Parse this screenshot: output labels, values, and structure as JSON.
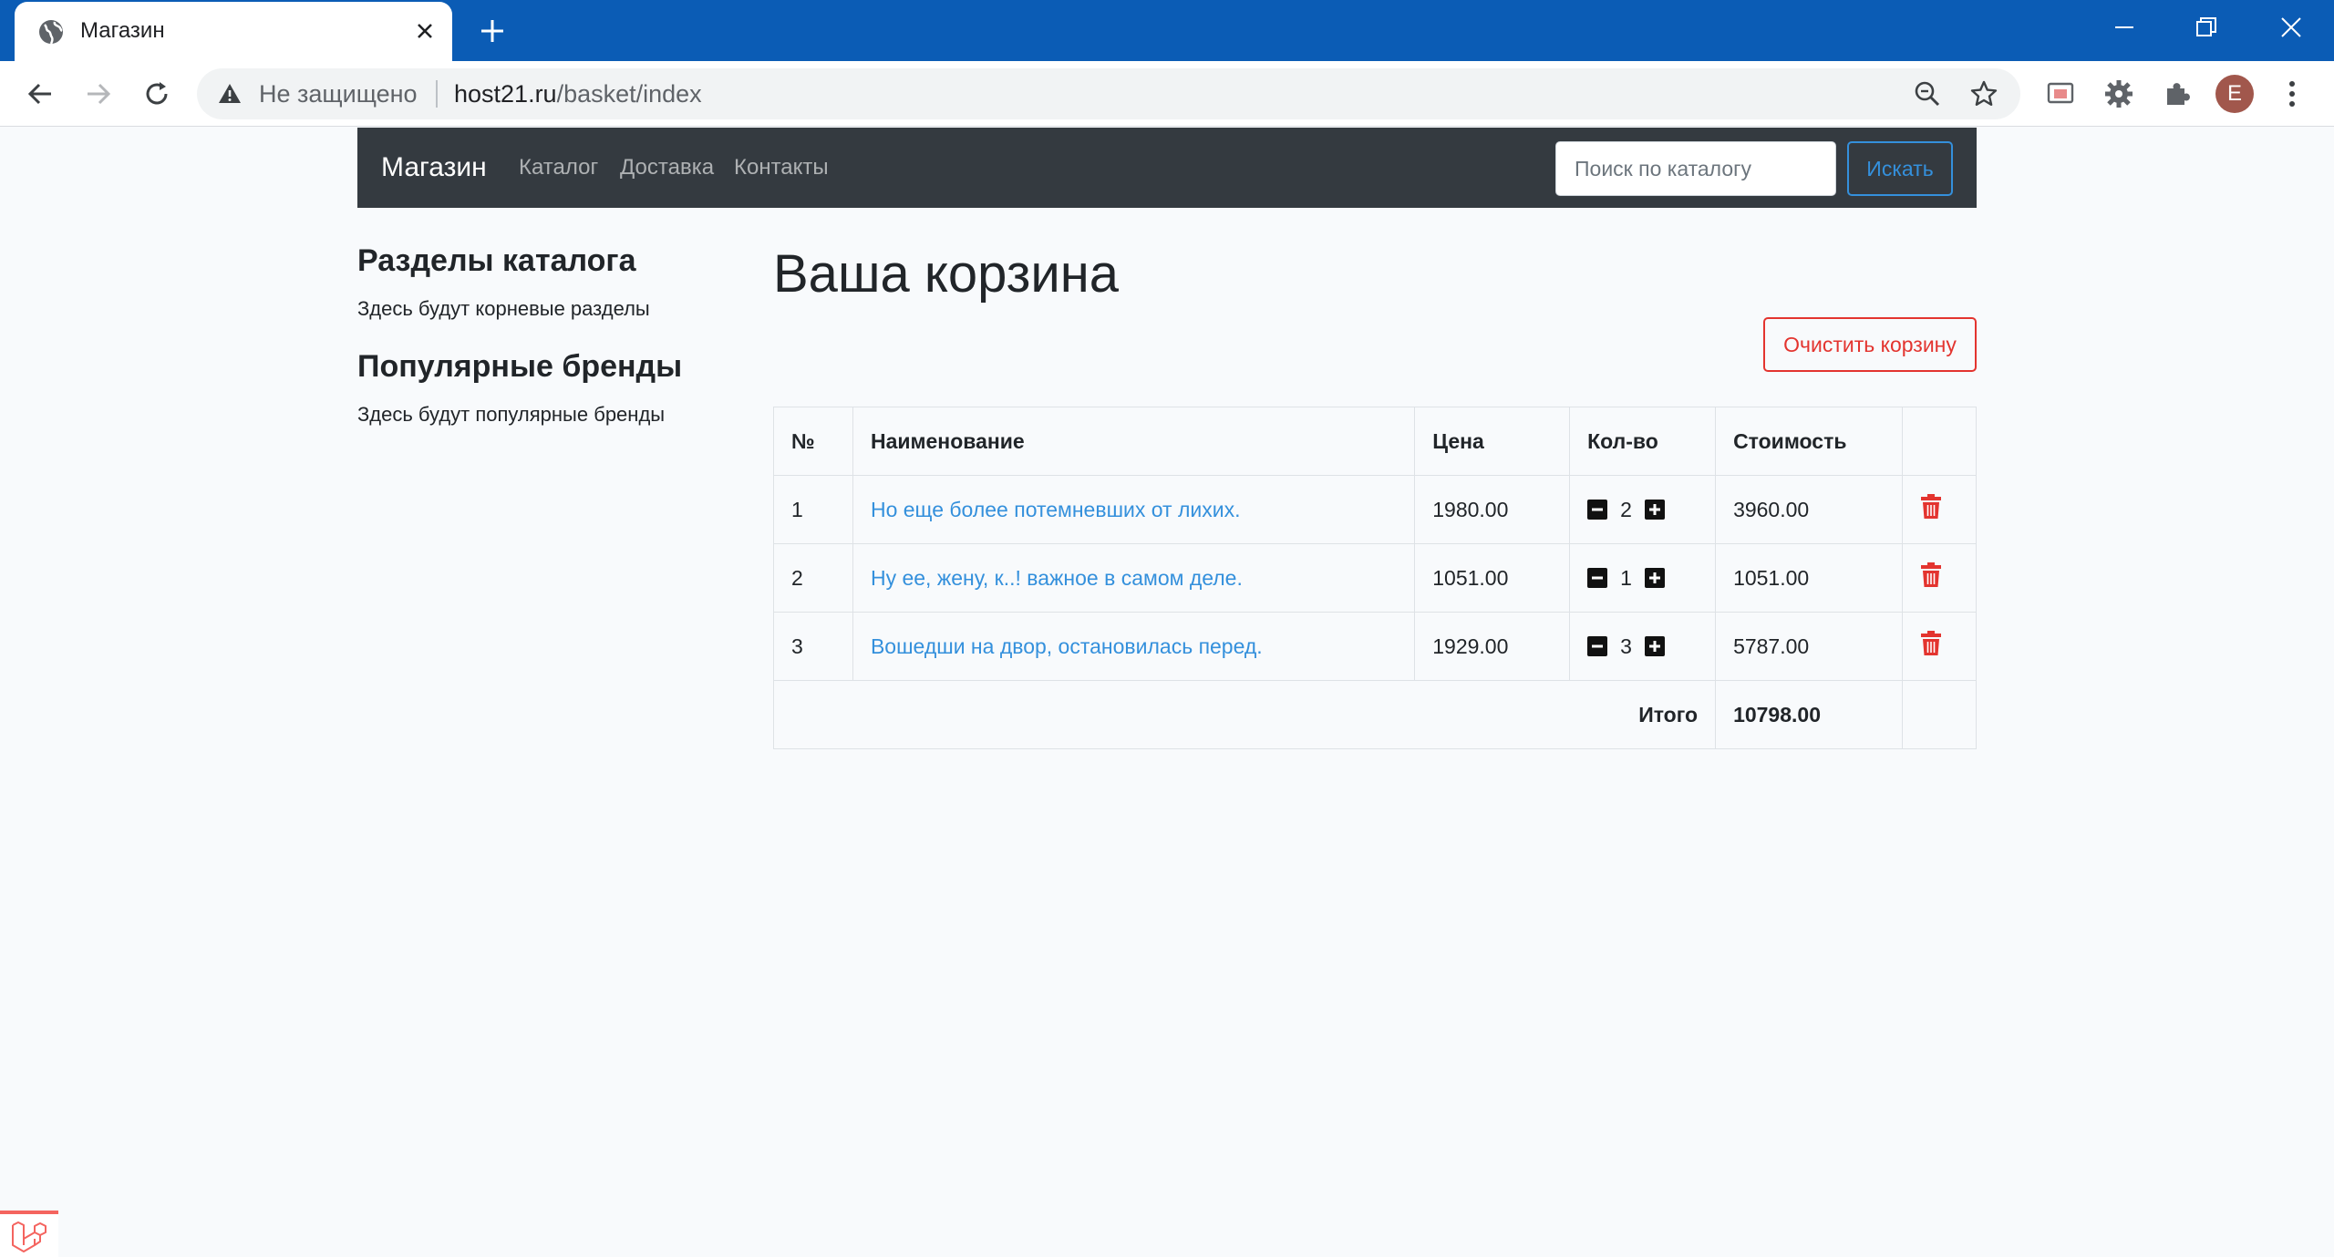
{
  "browser": {
    "tab_title": "Магазин",
    "security_label": "Не защищено",
    "url_host": "host21.ru",
    "url_path": "/basket/index",
    "profile_initial": "E"
  },
  "navbar": {
    "brand": "Магазин",
    "links": [
      "Каталог",
      "Доставка",
      "Контакты"
    ],
    "search_placeholder": "Поиск по каталогу",
    "search_button": "Искать"
  },
  "sidebar": {
    "sections": [
      {
        "heading": "Разделы каталога",
        "text": "Здесь будут корневые разделы"
      },
      {
        "heading": "Популярные бренды",
        "text": "Здесь будут популярные бренды"
      }
    ]
  },
  "main": {
    "title": "Ваша корзина",
    "clear_button": "Очистить корзину",
    "table": {
      "headers": [
        "№",
        "Наименование",
        "Цена",
        "Кол-во",
        "Стоимость",
        ""
      ],
      "rows": [
        {
          "num": "1",
          "name": "Но еще более потемневших от лихих.",
          "price": "1980.00",
          "qty": "2",
          "cost": "3960.00"
        },
        {
          "num": "2",
          "name": "Ну ее, жену, к..! важное в самом деле.",
          "price": "1051.00",
          "qty": "1",
          "cost": "1051.00"
        },
        {
          "num": "3",
          "name": "Вошедши на двор, остановилась перед.",
          "price": "1929.00",
          "qty": "3",
          "cost": "5787.00"
        }
      ],
      "total_label": "Итого",
      "total_value": "10798.00"
    }
  },
  "colors": {
    "primary": "#3490dc",
    "danger": "#e3342f",
    "navbar": "#343a40",
    "browser_tabbar": "#0b5cb5"
  }
}
